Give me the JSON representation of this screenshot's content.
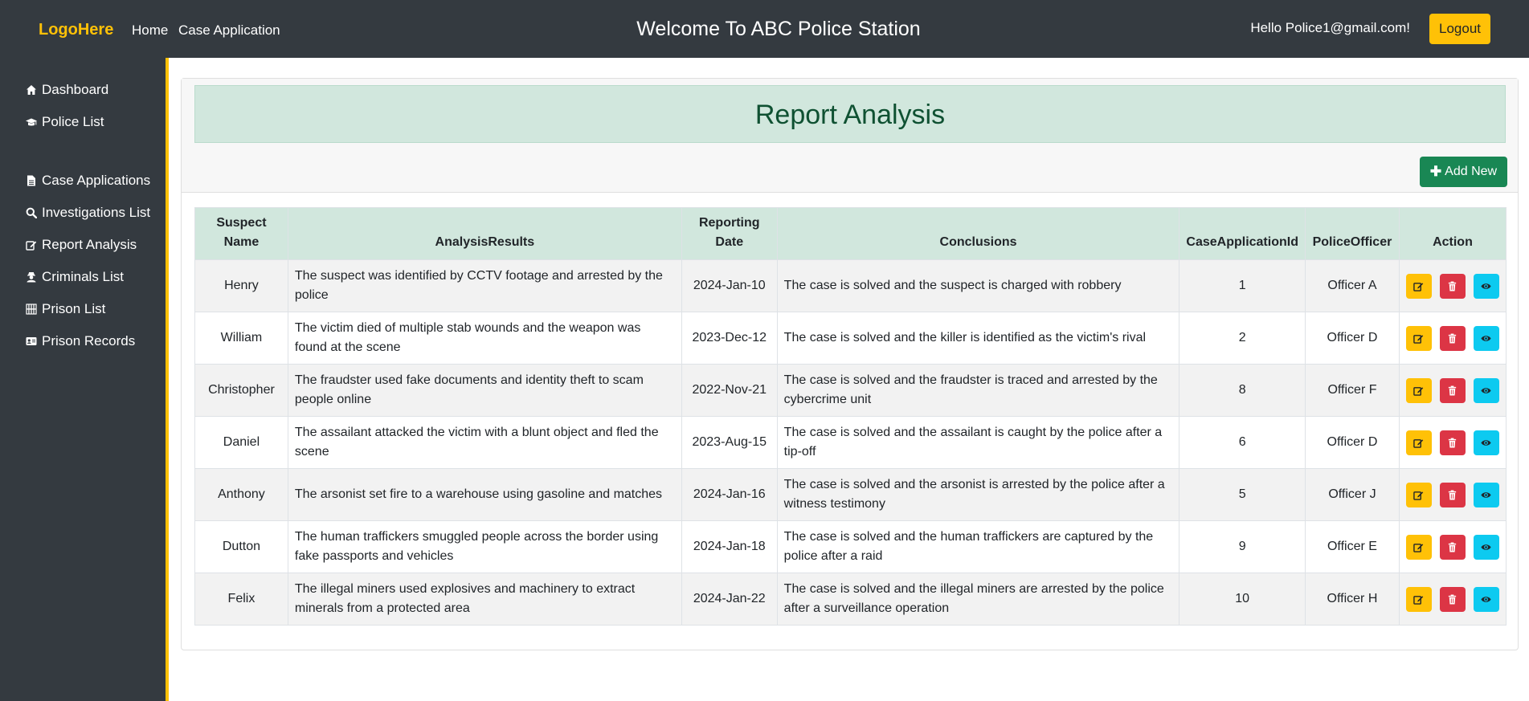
{
  "navbar": {
    "logo": "LogoHere",
    "links": [
      "Home",
      "Case Application"
    ],
    "welcome": "Welcome To ABC Police Station",
    "greeting": "Hello Police1@gmail.com!",
    "logout_label": "Logout"
  },
  "sidebar": {
    "items": [
      {
        "label": "Dashboard",
        "icon": "home-icon"
      },
      {
        "label": "Police List",
        "icon": "graduation-cap-icon"
      },
      {
        "label": "Case Applications",
        "icon": "file-icon"
      },
      {
        "label": "Investigations List",
        "icon": "search-icon"
      },
      {
        "label": "Report Analysis",
        "icon": "edit-icon"
      },
      {
        "label": "Criminals List",
        "icon": "user-secret-icon"
      },
      {
        "label": "Prison List",
        "icon": "prison-icon"
      },
      {
        "label": "Prison Records",
        "icon": "id-card-icon"
      }
    ]
  },
  "page": {
    "title": "Report Analysis",
    "add_label": "Add New"
  },
  "table": {
    "headers": [
      "Suspect Name",
      "AnalysisResults",
      "Reporting Date",
      "Conclusions",
      "CaseApplicationId",
      "PoliceOfficer",
      "Action"
    ],
    "rows": [
      {
        "suspect": "Henry",
        "analysis": "The suspect was identified by CCTV footage and arrested by the police",
        "date": "2024-Jan-10",
        "conclusion": "The case is solved and the suspect is charged with robbery",
        "case_id": "1",
        "officer": "Officer A"
      },
      {
        "suspect": "William",
        "analysis": "The victim died of multiple stab wounds and the weapon was found at the scene",
        "date": "2023-Dec-12",
        "conclusion": "The case is solved and the killer is identified as the victim's rival",
        "case_id": "2",
        "officer": "Officer D"
      },
      {
        "suspect": "Christopher",
        "analysis": "The fraudster used fake documents and identity theft to scam people online",
        "date": "2022-Nov-21",
        "conclusion": "The case is solved and the fraudster is traced and arrested by the cybercrime unit",
        "case_id": "8",
        "officer": "Officer F"
      },
      {
        "suspect": "Daniel",
        "analysis": "The assailant attacked the victim with a blunt object and fled the scene",
        "date": "2023-Aug-15",
        "conclusion": "The case is solved and the assailant is caught by the police after a tip-off",
        "case_id": "6",
        "officer": "Officer D"
      },
      {
        "suspect": "Anthony",
        "analysis": "The arsonist set fire to a warehouse using gasoline and matches",
        "date": "2024-Jan-16",
        "conclusion": "The case is solved and the arsonist is arrested by the police after a witness testimony",
        "case_id": "5",
        "officer": "Officer J"
      },
      {
        "suspect": "Dutton",
        "analysis": "The human traffickers smuggled people across the border using fake passports and vehicles",
        "date": "2024-Jan-18",
        "conclusion": "The case is solved and the human traffickers are captured by the police after a raid",
        "case_id": "9",
        "officer": "Officer E"
      },
      {
        "suspect": "Felix",
        "analysis": "The illegal miners used explosives and machinery to extract minerals from a protected area",
        "date": "2024-Jan-22",
        "conclusion": "The case is solved and the illegal miners are arrested by the police after a surveillance operation",
        "case_id": "10",
        "officer": "Officer H"
      }
    ]
  },
  "colors": {
    "navbar": "#343a40",
    "accent": "#ffc107",
    "title_bg": "#d1e7dd",
    "title_text": "#0f5132",
    "add_button": "#198754",
    "delete_button": "#dc3545",
    "view_button": "#0dcaf0"
  }
}
